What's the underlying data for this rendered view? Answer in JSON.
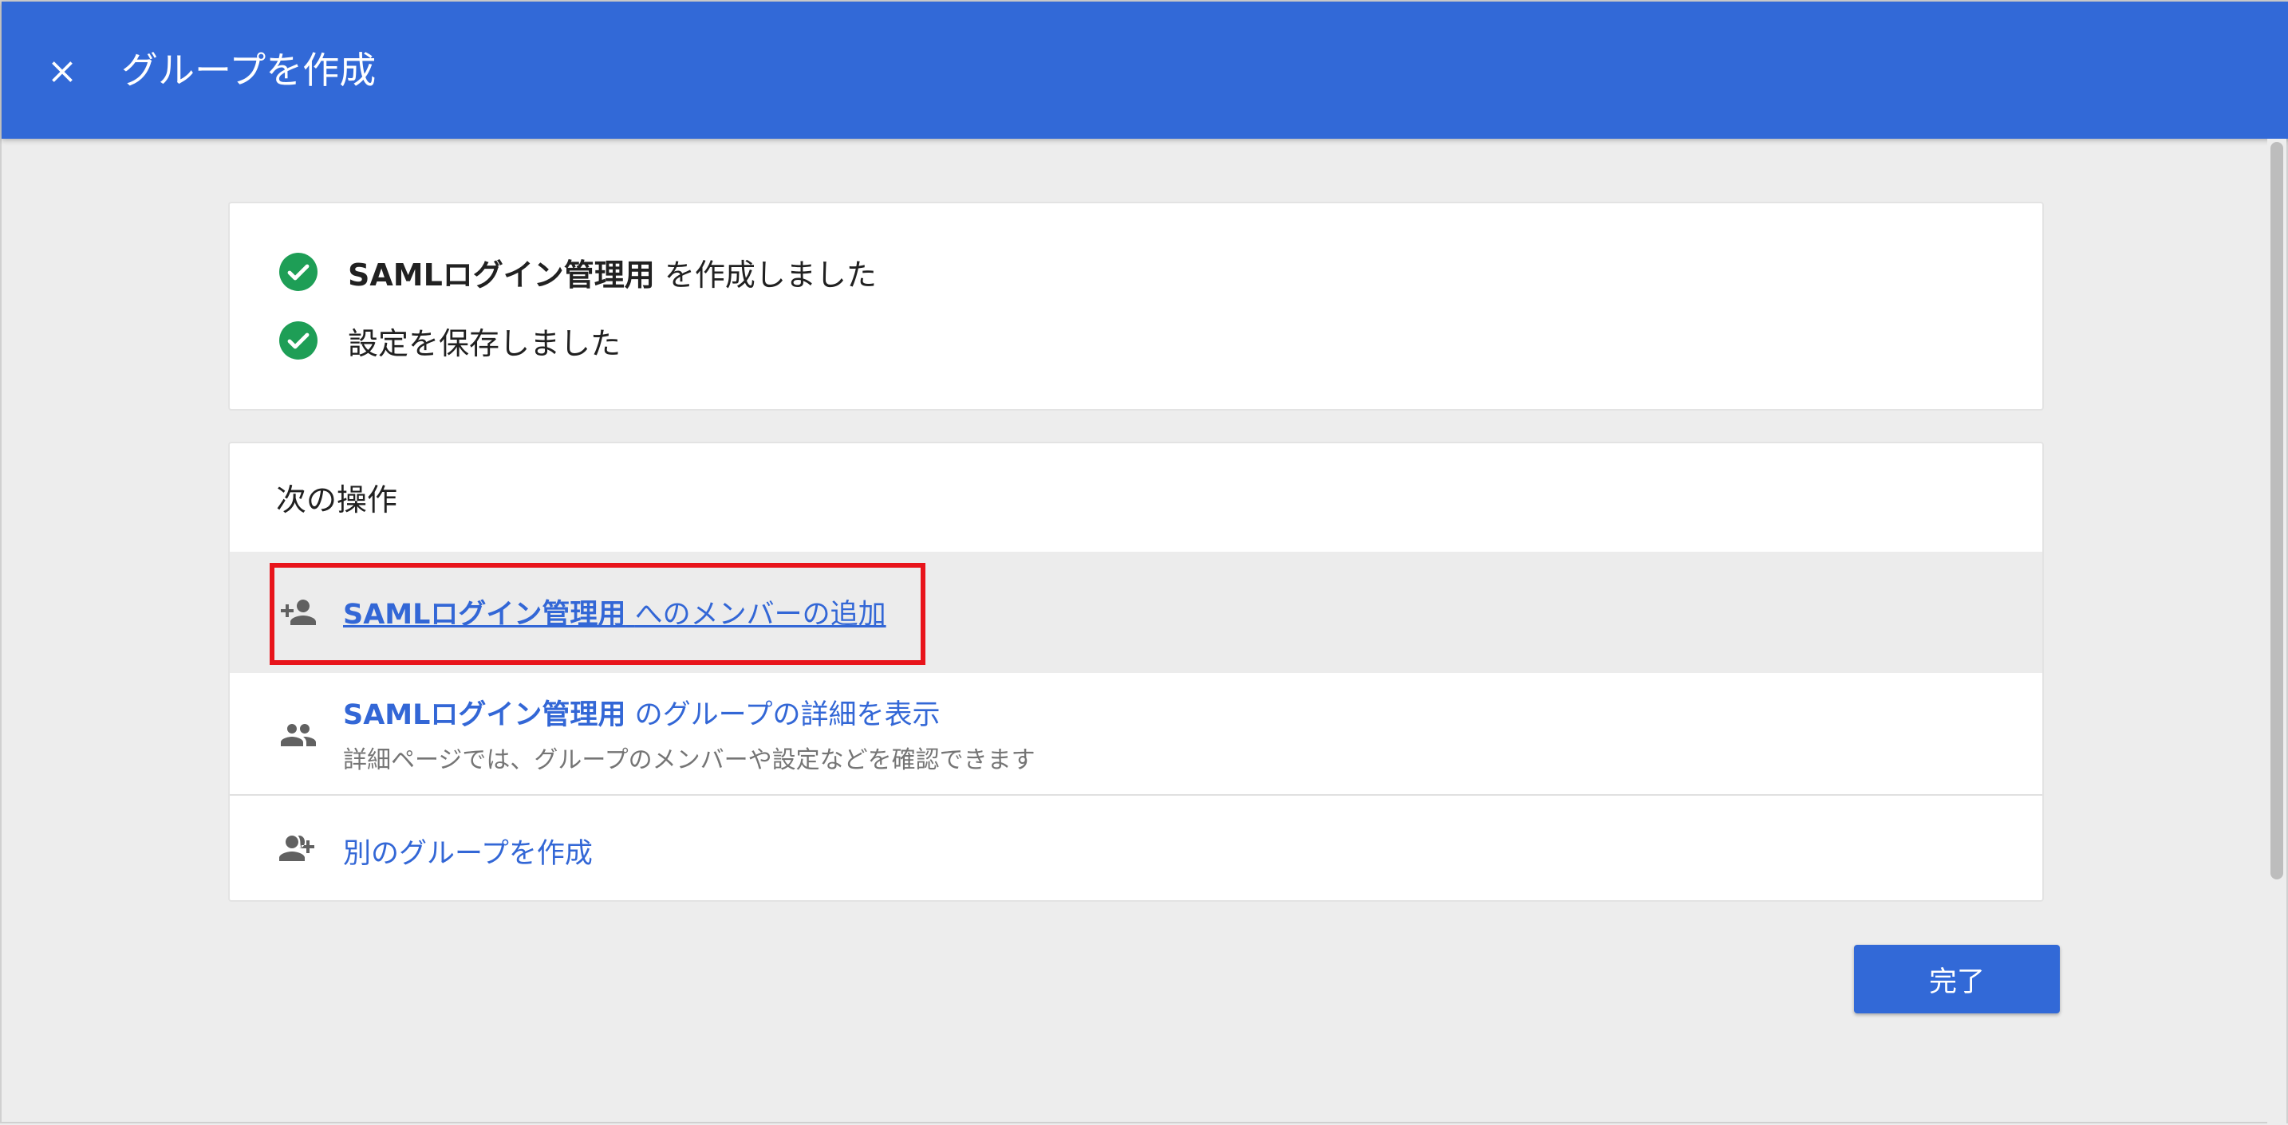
{
  "header": {
    "title": "グループを作成",
    "close_icon": "close-icon"
  },
  "colors": {
    "header_bg": "#3269d7",
    "success": "#1e9e56",
    "link": "#3367d6",
    "highlight": "#e8141b"
  },
  "status": {
    "items": [
      {
        "bold": "SAMLログイン管理用",
        "text": "を作成しました",
        "icon": "check-circle-icon"
      },
      {
        "bold": "",
        "text": "設定を保存しました",
        "icon": "check-circle-icon"
      }
    ]
  },
  "next_actions": {
    "title": "次の操作",
    "items": [
      {
        "bold": "SAMLログイン管理用",
        "text": "へのメンバーの追加",
        "icon": "person-add-icon"
      },
      {
        "bold": "SAMLログイン管理用",
        "text": "のグループの詳細を表示",
        "sub": "詳細ページでは、グループのメンバーや設定などを確認できます",
        "icon": "group-icon"
      },
      {
        "bold": "",
        "text": "別のグループを作成",
        "icon": "group-add-icon"
      }
    ]
  },
  "footer": {
    "done_label": "完了"
  }
}
